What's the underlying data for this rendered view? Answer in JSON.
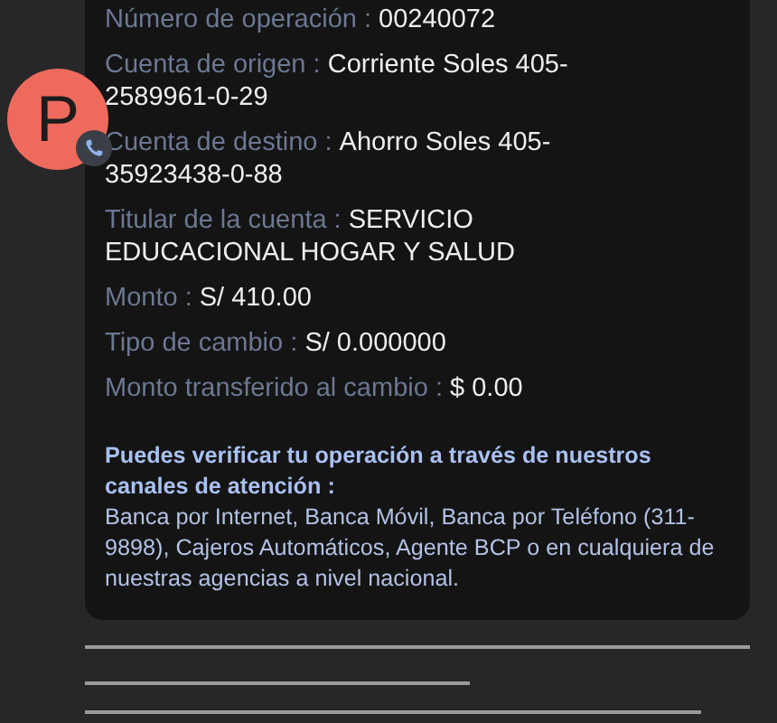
{
  "avatar": {
    "letter": "P"
  },
  "fields": [
    {
      "label": "Número de operación :",
      "value": "00240072"
    },
    {
      "label": "Cuenta de origen :",
      "value": "Corriente Soles 405-2589961-0-29"
    },
    {
      "label": "Cuenta de destino :",
      "value": "Ahorro Soles 405-35923438-0-88"
    },
    {
      "label": "Titular de la cuenta :",
      "value": "SERVICIO EDUCACIONAL HOGAR Y SALUD"
    },
    {
      "label": "Monto :",
      "value": "S/ 410.00"
    },
    {
      "label": "Tipo de cambio :",
      "value": "S/ 0.000000"
    },
    {
      "label": "Monto transferido al cambio :",
      "value": "$ 0.00"
    }
  ],
  "notice": {
    "heading": "Puedes verificar tu operación a través de nuestros canales de atención :",
    "body": "Banca por Internet, Banca Móvil, Banca por Teléfono (311-9898), Cajeros Automáticos, Agente BCP o en cualquiera de nuestras agencias a nivel nacional."
  }
}
